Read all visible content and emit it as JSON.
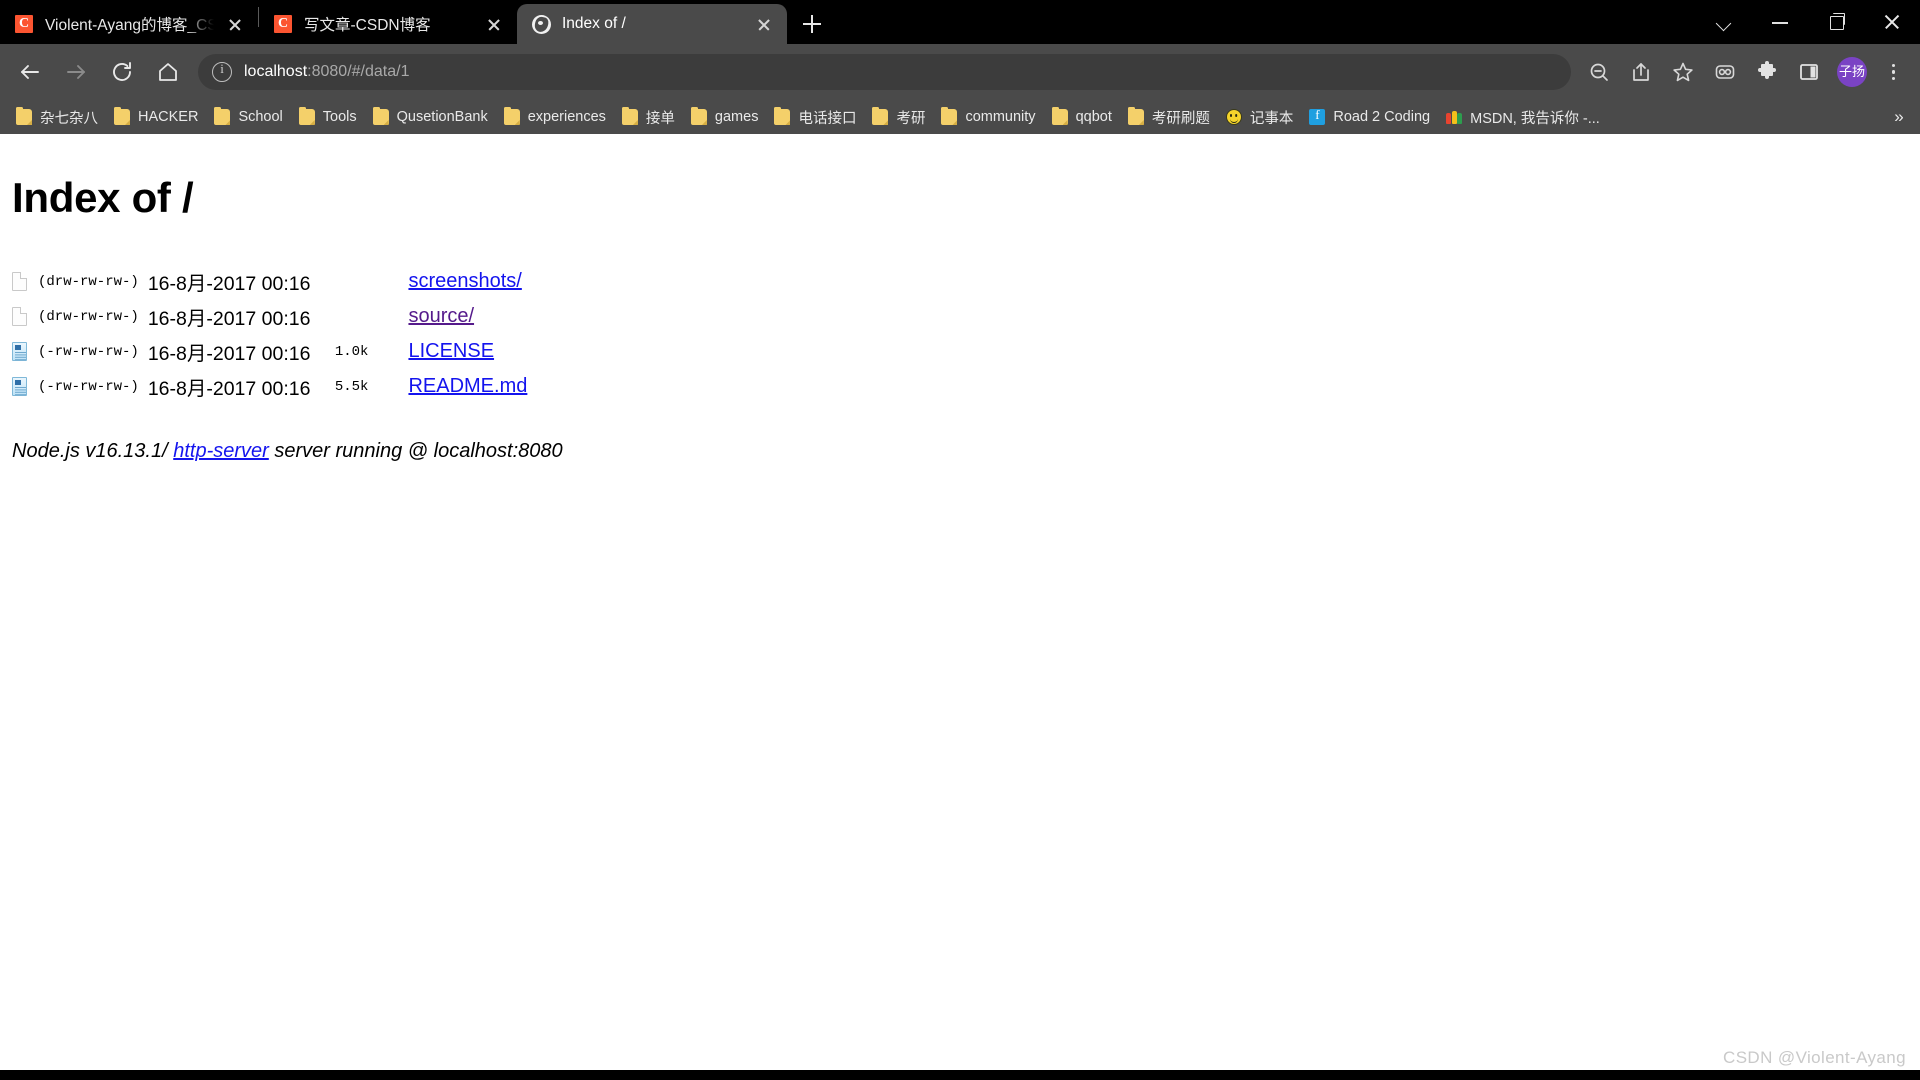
{
  "window": {
    "controls": {
      "tab_search": "tab-search",
      "minimize": "minimize",
      "maximize": "restore",
      "close": "close"
    }
  },
  "tabs": [
    {
      "title": "Violent-Ayang的博客_CSDN博客",
      "favicon": "csdn-icon",
      "active": false
    },
    {
      "title": "写文章-CSDN博客",
      "favicon": "csdn-icon",
      "active": false
    },
    {
      "title": "Index of /",
      "favicon": "globe-icon",
      "active": true
    }
  ],
  "newtab_label": "+",
  "toolbar": {
    "back": "back",
    "forward": "forward",
    "reload": "reload",
    "home": "home",
    "url": "localhost:8080/#/data/1",
    "url_host": "localhost",
    "url_path": ":8080/#/data/1",
    "icons": [
      "zoom-out-icon",
      "share-icon",
      "bookmark-star-icon",
      "reading-glasses-icon",
      "extensions-puzzle-icon",
      "side-panel-icon"
    ],
    "avatar_label": "子扬",
    "menu": "chrome-menu"
  },
  "bookmarks": {
    "items": [
      {
        "label": "杂七杂八",
        "icon": "folder-icon"
      },
      {
        "label": "HACKER",
        "icon": "folder-icon"
      },
      {
        "label": "School",
        "icon": "folder-icon"
      },
      {
        "label": "Tools",
        "icon": "folder-icon"
      },
      {
        "label": "QusetionBank",
        "icon": "folder-icon"
      },
      {
        "label": "experiences",
        "icon": "folder-icon"
      },
      {
        "label": "接单",
        "icon": "folder-icon"
      },
      {
        "label": "games",
        "icon": "folder-icon"
      },
      {
        "label": "电话接口",
        "icon": "folder-icon"
      },
      {
        "label": "考研",
        "icon": "folder-icon"
      },
      {
        "label": "community",
        "icon": "folder-icon"
      },
      {
        "label": "qqbot",
        "icon": "folder-icon"
      },
      {
        "label": "考研刷题",
        "icon": "folder-icon"
      },
      {
        "label": "记事本",
        "icon": "smiley-icon"
      },
      {
        "label": "Road 2 Coding",
        "icon": "r2c-icon"
      },
      {
        "label": "MSDN, 我告诉你 -...",
        "icon": "msdn-icon"
      }
    ],
    "overflow": "»"
  },
  "page": {
    "title": "Index of /",
    "rows": [
      {
        "icon": "document-icon",
        "permissions": "(drw-rw-rw-)",
        "date": "16-8月-2017 00:16",
        "size": "",
        "name": "screenshots/",
        "link_state": "link-new"
      },
      {
        "icon": "document-icon",
        "permissions": "(drw-rw-rw-)",
        "date": "16-8月-2017 00:16",
        "size": "",
        "name": "source/",
        "link_state": "link-visited"
      },
      {
        "icon": "text-file-icon",
        "permissions": "(-rw-rw-rw-)",
        "date": "16-8月-2017 00:16",
        "size": "1.0k",
        "name": "LICENSE",
        "link_state": "link-new"
      },
      {
        "icon": "text-file-icon",
        "permissions": "(-rw-rw-rw-)",
        "date": "16-8月-2017 00:16",
        "size": "5.5k",
        "name": "README.md",
        "link_state": "link-new"
      }
    ],
    "footer": {
      "prefix": "Node.js v16.13.1/ ",
      "link": "http-server",
      "suffix": " server running @ localhost:8080"
    },
    "watermark": "CSDN @Violent-Ayang"
  },
  "colors": {
    "chrome_bg": "#4a4a4a",
    "tabstrip_bg": "#000000",
    "link": "#1414ee",
    "visited_link": "#551a8b",
    "accent_csdn": "#fc5531",
    "avatar_bg": "#7a43c4",
    "folder": "#f4d06a"
  }
}
